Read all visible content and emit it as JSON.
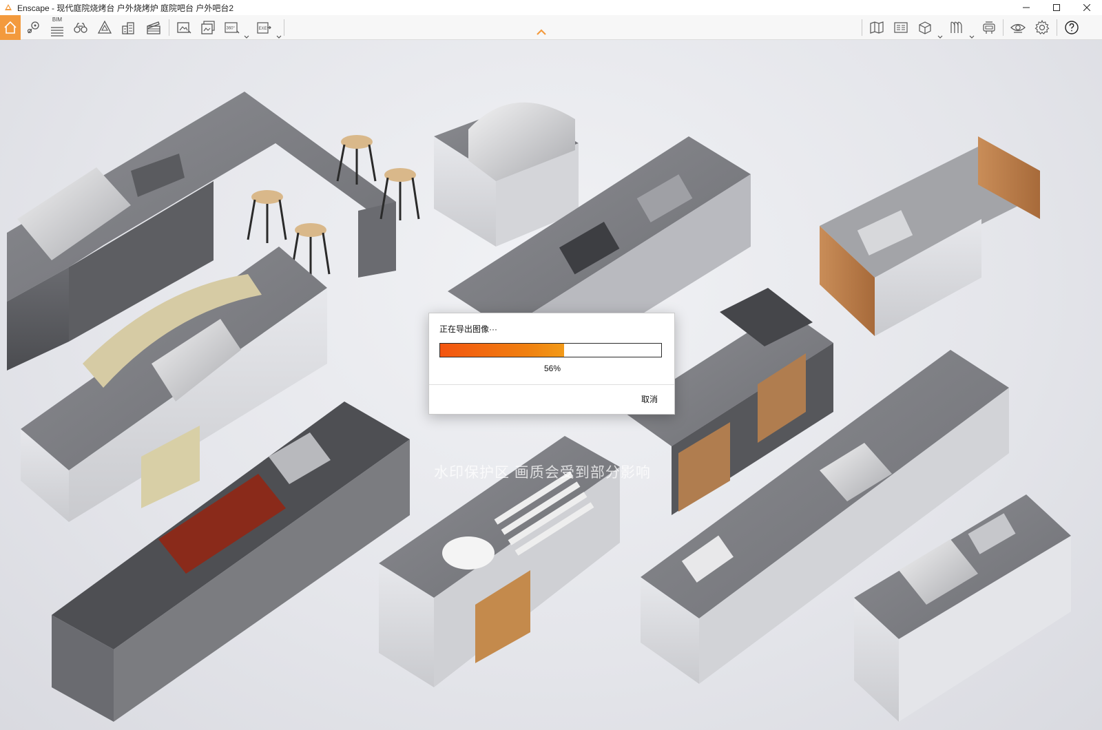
{
  "window": {
    "title": "Enscape - 现代庭院烧烤台 户外烧烤炉 庭院吧台 户外吧台2"
  },
  "toolbar": {
    "bim_label": "BIM",
    "left_icons": [
      "home-icon",
      "map-pin-icon",
      "bim-list-icon",
      "binoculars-icon",
      "asset-library-icon",
      "buildings-icon",
      "clapperboard-icon",
      "screenshot-icon",
      "batch-render-icon",
      "panorama-360-icon",
      "export-exe-icon"
    ],
    "right_icons": [
      "site-context-icon",
      "atlas-icon",
      "cube-view-icon",
      "material-editor-icon",
      "vr-headset-icon",
      "visual-settings-icon",
      "settings-gear-icon",
      "help-icon"
    ],
    "panorama_label": "360°",
    "exe_label": "EXE",
    "accent_color": "#f39a3d"
  },
  "viewport": {
    "scene": "outdoor BBQ kitchen islands",
    "watermark_text": "水印保护区  画质会受到部分影响"
  },
  "dialog": {
    "title": "正在导出图像···",
    "progress_percent": 56,
    "progress_label": "56%",
    "cancel_label": "取消",
    "progress_colors": [
      "#f35510",
      "#f29a18"
    ]
  }
}
